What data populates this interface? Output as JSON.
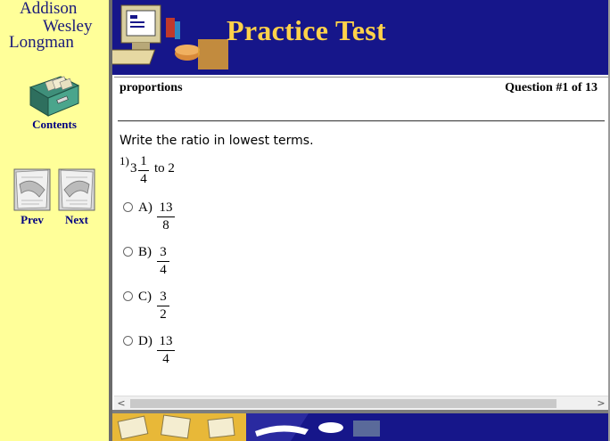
{
  "sidebar": {
    "logo": {
      "line1": "Addison",
      "line2": "Wesley",
      "line3": "Longman"
    },
    "contents_label": "Contents",
    "prev_label": "Prev",
    "next_label": "Next",
    "icons": [
      "file-box-icon",
      "prev-page-icon",
      "next-page-icon"
    ]
  },
  "banner": {
    "title": "Practice Test"
  },
  "question": {
    "topic": "proportions",
    "counter": "Question #1 of 13",
    "instruction": "Write the ratio in lowest terms.",
    "number": "1)",
    "whole": "3",
    "frac_num": "1",
    "frac_den": "4",
    "suffix": "to 2"
  },
  "options": [
    {
      "letter": "A)",
      "num": "13",
      "den": "8"
    },
    {
      "letter": "B)",
      "num": "3",
      "den": "4"
    },
    {
      "letter": "C)",
      "num": "3",
      "den": "2"
    },
    {
      "letter": "D)",
      "num": "13",
      "den": "4"
    }
  ],
  "scrollbar": {
    "left_arrow": "<",
    "right_arrow": ">"
  },
  "colors": {
    "sidebar_bg": "#FFFF99",
    "banner_bg": "#16168a",
    "banner_title": "#FFD24A",
    "nav_text": "#000080"
  }
}
